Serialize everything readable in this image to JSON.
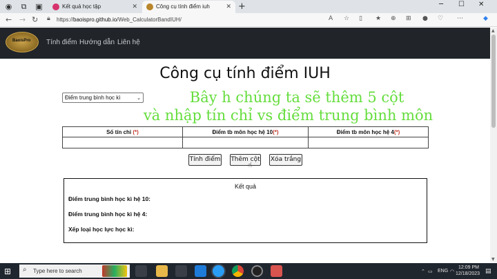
{
  "browser": {
    "tabs": [
      {
        "title": "Kết quả học tập",
        "active": false
      },
      {
        "title": "Công cụ tính điểm iuh",
        "active": true
      }
    ],
    "new_tab": "+",
    "url_scheme": "https://",
    "url_host": "baoispro.github.io",
    "url_path": "/Web_CalculatorBandIUH/"
  },
  "navbar": {
    "logo_text": "BaoisPro",
    "links": [
      "Tính điểm",
      "Hướng dẫn",
      "Liên hệ"
    ]
  },
  "main": {
    "title": "Công cụ tính điểm IUH",
    "select_value": "Điểm trung bình học kì",
    "overlay_line1": "Bây h chúng ta sẽ thêm 5 cột",
    "overlay_line2": "và nhập tín chỉ vs điểm trung bình môn",
    "table_headers": [
      {
        "label": "Số tín chỉ ",
        "req": "(*)"
      },
      {
        "label": "Điểm tb môn học hệ 10",
        "req": "(*)"
      },
      {
        "label": "Điểm tb môn học hệ 4",
        "req": "(*)"
      }
    ],
    "buttons": {
      "calculate": "Tính điểm",
      "add_column": "Thêm cột",
      "clear": "Xóa trắng"
    },
    "result": {
      "title": "Kết quả",
      "line1": "Điểm trung bình học kì hệ 10:",
      "line2": "Điểm trung bình học kì hệ 4:",
      "line3": "Xếp loại học lực học kì:"
    }
  },
  "taskbar": {
    "search_placeholder": "Type here to search",
    "language": "ENG",
    "time": "12:09 PM",
    "date": "12/18/2023"
  },
  "colors": {
    "navbar_bg": "#212529",
    "overlay_text": "#64dd3c",
    "required_mark": "#c0392b"
  }
}
